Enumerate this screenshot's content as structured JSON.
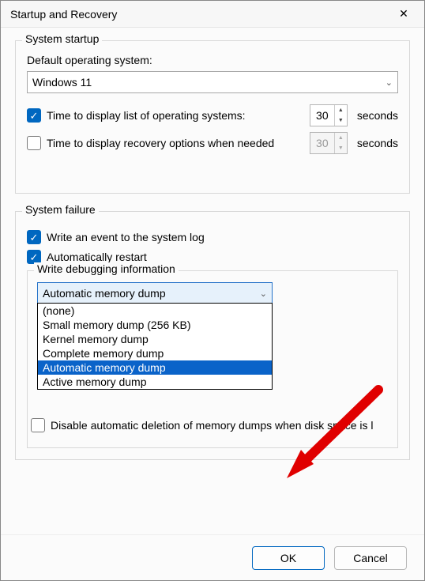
{
  "window": {
    "title": "Startup and Recovery",
    "close_icon": "✕"
  },
  "startup": {
    "legend": "System startup",
    "default_os_label": "Default operating system:",
    "default_os_value": "Windows 11",
    "display_list": {
      "checked": true,
      "label": "Time to display list of operating systems:",
      "value": "30",
      "suffix": "seconds"
    },
    "display_recovery": {
      "checked": false,
      "label": "Time to display recovery options when needed",
      "value": "30",
      "suffix": "seconds"
    }
  },
  "failure": {
    "legend": "System failure",
    "write_event": {
      "checked": true,
      "label": "Write an event to the system log"
    },
    "auto_restart": {
      "checked": true,
      "label": "Automatically restart"
    },
    "debug": {
      "legend": "Write debugging information",
      "selected": "Automatic memory dump",
      "options": [
        "(none)",
        "Small memory dump (256 KB)",
        "Kernel memory dump",
        "Complete memory dump",
        "Automatic memory dump",
        "Active memory dump"
      ],
      "highlight_index": 4,
      "disable_auto_delete": {
        "checked": false,
        "label": "Disable automatic deletion of memory dumps when disk space is l"
      }
    }
  },
  "buttons": {
    "ok": "OK",
    "cancel": "Cancel"
  },
  "icons": {
    "check": "✓",
    "chev_down": "⌄",
    "tri_up": "▲",
    "tri_down": "▼"
  }
}
